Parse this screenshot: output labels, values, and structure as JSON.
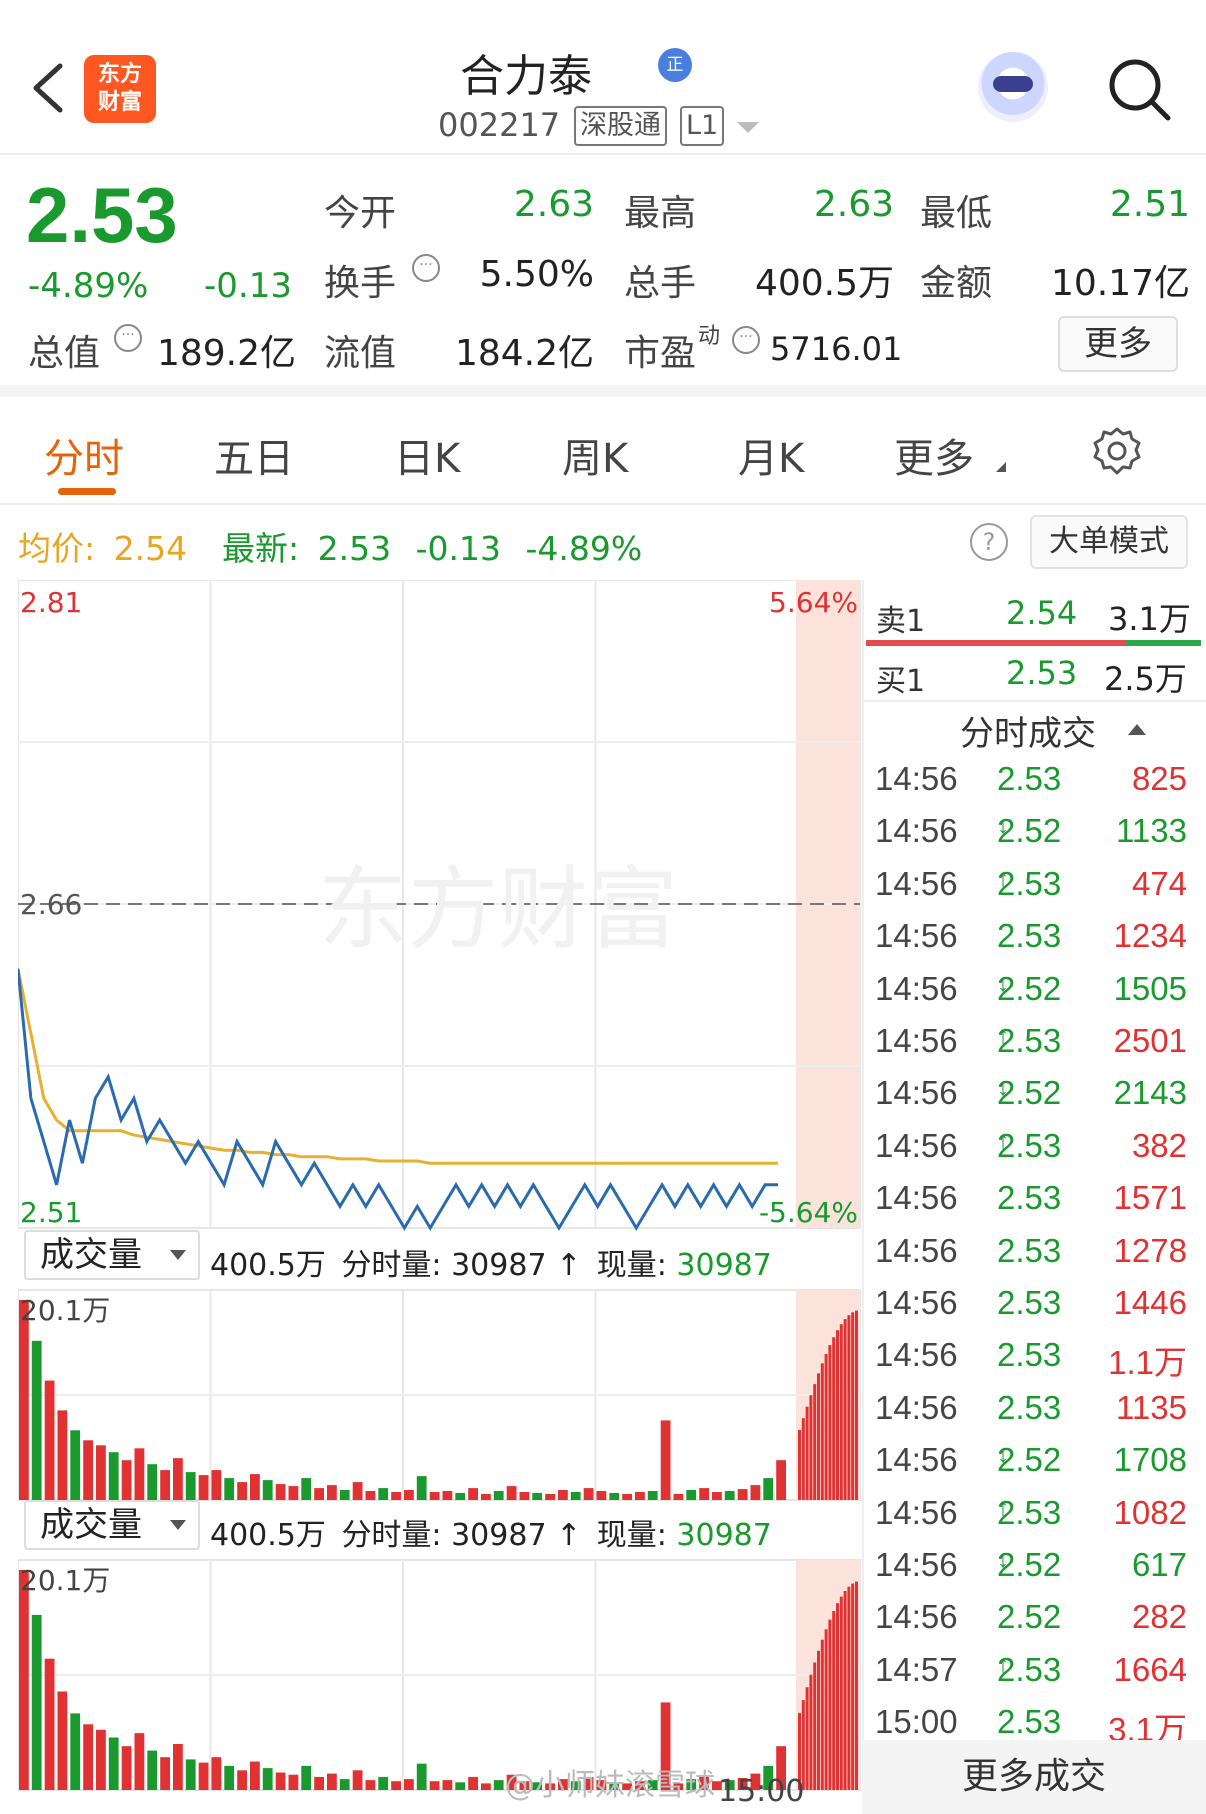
{
  "header": {
    "logo_text": "东方财富",
    "stock_name": "合力泰",
    "rzq_badge": "正",
    "stock_code": "002217",
    "tags": [
      "深股通",
      "L1"
    ]
  },
  "quote": {
    "price": "2.53",
    "change_pct": "-4.89%",
    "change": "-0.13",
    "fields": {
      "open_label": "今开",
      "open": "2.63",
      "high_label": "最高",
      "high": "2.63",
      "low_label": "最低",
      "low": "2.51",
      "turnover_label": "换手",
      "turnover": "5.50%",
      "volume_label": "总手",
      "volume": "400.5万",
      "amount_label": "金额",
      "amount": "10.17亿",
      "mktcap_label": "总值",
      "mktcap": "189.2亿",
      "float_label": "流值",
      "float": "184.2亿",
      "pe_label": "市盈",
      "pe_sup": "动",
      "pe": "5716.01"
    },
    "more_button": "更多"
  },
  "tabs": [
    "分时",
    "五日",
    "日K",
    "周K",
    "月K",
    "更多"
  ],
  "active_tab": 0,
  "info_row": {
    "avg_label": "均价:",
    "avg_value": "2.54",
    "latest_label": "最新:",
    "latest_value": "2.53",
    "latest_change": "-0.13",
    "latest_pct": "-4.89%",
    "help": "?",
    "big_order_button": "大单模式"
  },
  "chart_data": [
    {
      "type": "line",
      "title": "",
      "ylim": [
        2.51,
        2.81
      ],
      "y_ticks_left": [
        "2.81",
        "2.66",
        "2.51"
      ],
      "y_ticks_right": [
        "5.64%",
        "-5.64%"
      ],
      "prev_close": 2.66,
      "x_end_label": "15:00",
      "series": [
        {
          "name": "",
          "color": "#2a6bb0",
          "values": [
            2.63,
            2.57,
            2.55,
            2.53,
            2.56,
            2.54,
            2.57,
            2.58,
            2.56,
            2.57,
            2.55,
            2.56,
            2.55,
            2.54,
            2.55,
            2.54,
            2.53,
            2.55,
            2.54,
            2.53,
            2.55,
            2.54,
            2.53,
            2.54,
            2.53,
            2.52,
            2.53,
            2.52,
            2.53,
            2.52,
            2.51,
            2.52,
            2.51,
            2.52,
            2.53,
            2.52,
            2.53,
            2.52,
            2.53,
            2.52,
            2.53,
            2.52,
            2.51,
            2.52,
            2.53,
            2.52,
            2.53,
            2.52,
            2.51,
            2.52,
            2.53,
            2.52,
            2.53,
            2.52,
            2.53,
            2.52,
            2.53,
            2.52,
            2.53,
            2.53
          ]
        },
        {
          "name": "",
          "color": "#e8b030",
          "values": [
            2.63,
            2.6,
            2.57,
            2.56,
            2.555,
            2.555,
            2.555,
            2.555,
            2.555,
            2.553,
            2.552,
            2.551,
            2.55,
            2.549,
            2.548,
            2.547,
            2.546,
            2.546,
            2.545,
            2.545,
            2.544,
            2.544,
            2.543,
            2.543,
            2.543,
            2.542,
            2.542,
            2.542,
            2.541,
            2.541,
            2.541,
            2.541,
            2.54,
            2.54,
            2.54,
            2.54,
            2.54,
            2.54,
            2.54,
            2.54,
            2.54,
            2.54,
            2.54,
            2.54,
            2.54,
            2.54,
            2.54,
            2.54,
            2.54,
            2.54,
            2.54,
            2.54,
            2.54,
            2.54,
            2.54,
            2.54,
            2.54,
            2.54,
            2.54,
            2.54
          ]
        }
      ]
    },
    {
      "type": "bar",
      "title": "成交量",
      "ymax_label": "20.1万",
      "ylim": [
        0,
        201000
      ],
      "values": [
        201000,
        160000,
        120000,
        90000,
        70000,
        60000,
        55000,
        48000,
        40000,
        52000,
        36000,
        30000,
        42000,
        28000,
        25000,
        30000,
        22000,
        18000,
        26000,
        20000,
        16000,
        14000,
        22000,
        12000,
        15000,
        10000,
        18000,
        9000,
        12000,
        8000,
        10000,
        24000,
        8000,
        9000,
        7000,
        12000,
        6000,
        9000,
        14000,
        8000,
        7000,
        6000,
        10000,
        8000,
        12000,
        9000,
        7000,
        6000,
        8000,
        9000,
        80000,
        6000,
        10000,
        12000,
        8000,
        9000,
        11000,
        15000,
        22000,
        40000
      ]
    }
  ],
  "volume_panels": [
    {
      "selector": "成交量",
      "total": "400.5万",
      "minute_label": "分时量:",
      "minute_value": "30987",
      "arrow": "↑",
      "current_label": "现量:",
      "current_value": "30987",
      "max_label": "20.1万"
    },
    {
      "selector": "成交量",
      "total": "400.5万",
      "minute_label": "分时量:",
      "minute_value": "30987",
      "arrow": "↑",
      "current_label": "现量:",
      "current_value": "30987",
      "max_label": "20.1万"
    }
  ],
  "orderbook": {
    "sell": {
      "label": "卖1",
      "price": "2.54",
      "volume": "3.1万"
    },
    "buy": {
      "label": "买1",
      "price": "2.53",
      "volume": "2.5万"
    }
  },
  "ticks_header": "分时成交",
  "ticks": [
    {
      "time": "14:56",
      "price": "2.53",
      "dir": "",
      "vol": "825",
      "vol_color": "red"
    },
    {
      "time": "14:56",
      "price": "2.52",
      "dir": "↓",
      "vol": "1133",
      "vol_color": "green"
    },
    {
      "time": "14:56",
      "price": "2.53",
      "dir": "↑",
      "vol": "474",
      "vol_color": "red"
    },
    {
      "time": "14:56",
      "price": "2.53",
      "dir": "",
      "vol": "1234",
      "vol_color": "red"
    },
    {
      "time": "14:56",
      "price": "2.52",
      "dir": "↓",
      "vol": "1505",
      "vol_color": "green"
    },
    {
      "time": "14:56",
      "price": "2.53",
      "dir": "↑",
      "vol": "2501",
      "vol_color": "red"
    },
    {
      "time": "14:56",
      "price": "2.52",
      "dir": "↓",
      "vol": "2143",
      "vol_color": "green"
    },
    {
      "time": "14:56",
      "price": "2.53",
      "dir": "↑",
      "vol": "382",
      "vol_color": "red"
    },
    {
      "time": "14:56",
      "price": "2.53",
      "dir": "",
      "vol": "1571",
      "vol_color": "red"
    },
    {
      "time": "14:56",
      "price": "2.53",
      "dir": "",
      "vol": "1278",
      "vol_color": "red"
    },
    {
      "time": "14:56",
      "price": "2.53",
      "dir": "",
      "vol": "1446",
      "vol_color": "red"
    },
    {
      "time": "14:56",
      "price": "2.53",
      "dir": "",
      "vol": "1.1万",
      "vol_color": "red"
    },
    {
      "time": "14:56",
      "price": "2.53",
      "dir": "",
      "vol": "1135",
      "vol_color": "red"
    },
    {
      "time": "14:56",
      "price": "2.52",
      "dir": "↓",
      "vol": "1708",
      "vol_color": "green"
    },
    {
      "time": "14:56",
      "price": "2.53",
      "dir": "↑",
      "vol": "1082",
      "vol_color": "red"
    },
    {
      "time": "14:56",
      "price": "2.52",
      "dir": "↓",
      "vol": "617",
      "vol_color": "green"
    },
    {
      "time": "14:56",
      "price": "2.52",
      "dir": "",
      "vol": "282",
      "vol_color": "red"
    },
    {
      "time": "14:57",
      "price": "2.53",
      "dir": "↑",
      "vol": "1664",
      "vol_color": "red"
    },
    {
      "time": "15:00",
      "price": "2.53",
      "dir": "",
      "vol": "3.1万",
      "vol_color": "red"
    }
  ],
  "more_trades_button": "更多成交",
  "watermark": "@小师妹滚雪球"
}
